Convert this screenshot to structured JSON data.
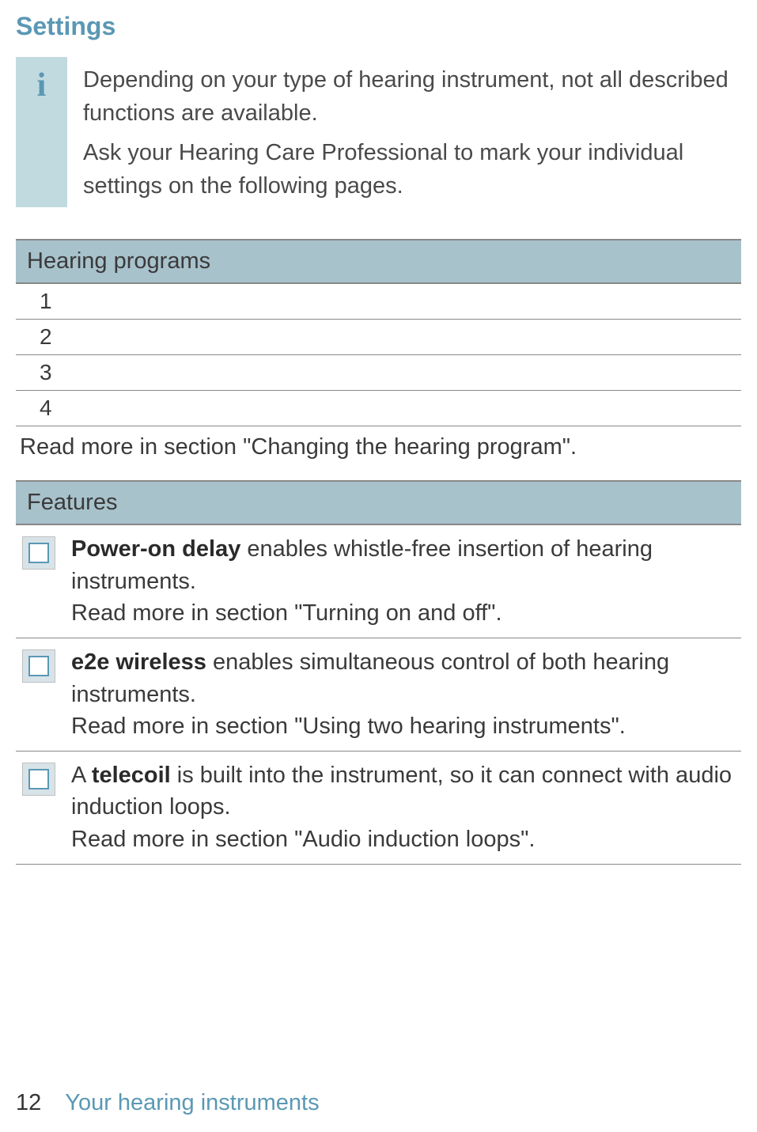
{
  "title": "Settings",
  "info": {
    "para1": "Depending on your type of hearing instrument, not all described functions are available.",
    "para2": "Ask your Hearing Care Professional to mark your individual settings on the following pages."
  },
  "hearing_programs": {
    "header": "Hearing programs",
    "rows": [
      "1",
      "2",
      "3",
      "4"
    ],
    "read_more": "Read more in section \"Changing the hearing program\"."
  },
  "features": {
    "header": "Features",
    "items": [
      {
        "bold": "Power-on delay",
        "desc": " enables whistle-free insertion of hearing instruments.",
        "read_more": "Read more in section \"Turning on and off\"."
      },
      {
        "bold": "e2e wireless",
        "desc": " enables simultaneous control of both hearing instruments.",
        "read_more": "Read more in section \"Using two hearing instruments\"."
      },
      {
        "prefix": "A ",
        "bold": "telecoil",
        "desc": " is built into the instrument, so it can connect with audio induction loops.",
        "read_more": "Read more in section \"Audio induction loops\"."
      }
    ]
  },
  "footer": {
    "page_number": "12",
    "text": "Your hearing instruments"
  }
}
